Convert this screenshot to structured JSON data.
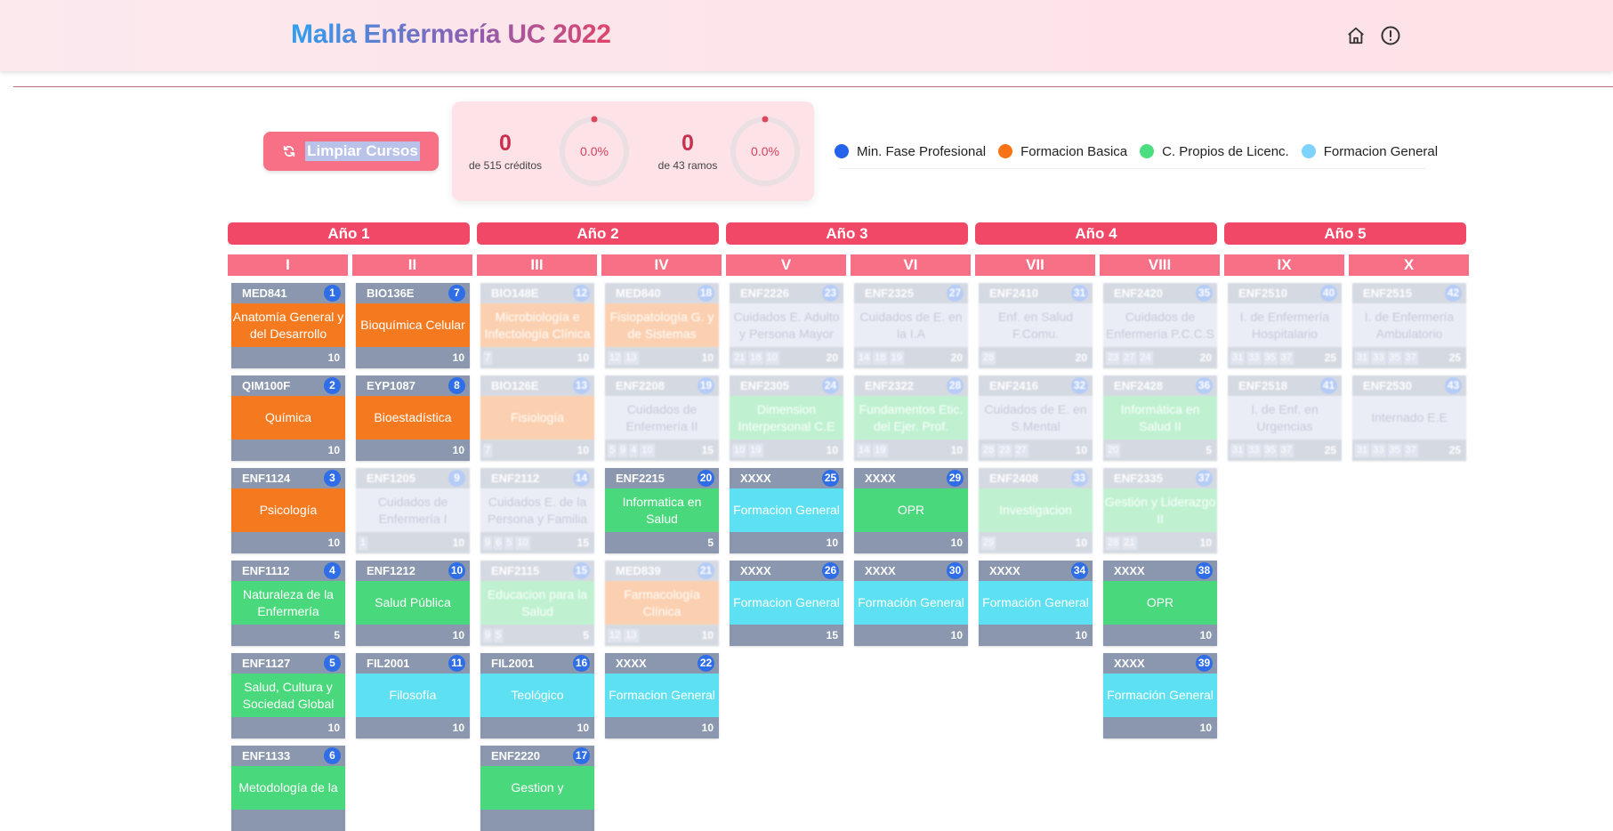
{
  "header": {
    "title": "Malla Enfermería UC 2022",
    "icons": [
      "home-icon",
      "alert-icon"
    ]
  },
  "controls": {
    "clear_label": "Limpiar Cursos",
    "clear_icon": "refresh-icon"
  },
  "stats": {
    "credits_value": "0",
    "credits_label": "de 515 créditos",
    "credits_percent": "0.0%",
    "courses_value": "0",
    "courses_label": "de 43 ramos",
    "courses_percent": "0.0%"
  },
  "legend": [
    {
      "label": "Min. Fase Profesional",
      "color": "#2563eb"
    },
    {
      "label": "Formacion Basica",
      "color": "#f97316"
    },
    {
      "label": "C. Propios de Licenc.",
      "color": "#4ade80"
    },
    {
      "label": "Formacion General",
      "color": "#7dd3fc"
    }
  ],
  "category_colors": {
    "basica": "#f57a1f",
    "licenc": "#49d97c",
    "general": "#5de0f2",
    "profesional": "#c8cde8"
  },
  "years": [
    "Año 1",
    "Año 2",
    "Año 3",
    "Año 4",
    "Año 5"
  ],
  "semesters": [
    "I",
    "II",
    "III",
    "IV",
    "V",
    "VI",
    "VII",
    "VIII",
    "IX",
    "X"
  ],
  "columns": [
    [
      {
        "code": "MED841",
        "num": "1",
        "name": "Anatomía General y del Desarrollo",
        "credits": "10",
        "prereqs": [],
        "cat": "basica",
        "active": true
      },
      {
        "code": "QIM100F",
        "num": "2",
        "name": "Química",
        "credits": "10",
        "prereqs": [],
        "cat": "basica",
        "active": true
      },
      {
        "code": "ENF1124",
        "num": "3",
        "name": "Psicología",
        "credits": "10",
        "prereqs": [],
        "cat": "basica",
        "active": true
      },
      {
        "code": "ENF1112",
        "num": "4",
        "name": "Naturaleza de la Enfermería",
        "credits": "5",
        "prereqs": [],
        "cat": "licenc",
        "active": true
      },
      {
        "code": "ENF1127",
        "num": "5",
        "name": "Salud, Cultura y Sociedad Global",
        "credits": "10",
        "prereqs": [],
        "cat": "licenc",
        "active": true
      },
      {
        "code": "ENF1133",
        "num": "6",
        "name": "Metodología de la",
        "credits": "",
        "prereqs": [],
        "cat": "licenc",
        "active": true
      }
    ],
    [
      {
        "code": "BIO136E",
        "num": "7",
        "name": "Bioquímica Celular",
        "credits": "10",
        "prereqs": [],
        "cat": "basica",
        "active": true
      },
      {
        "code": "EYP1087",
        "num": "8",
        "name": "Bioestadística",
        "credits": "10",
        "prereqs": [],
        "cat": "basica",
        "active": true
      },
      {
        "code": "ENF1205",
        "num": "9",
        "name": "Cuidados de Enfermería I",
        "credits": "10",
        "prereqs": [
          "1"
        ],
        "cat": "profesional",
        "active": false
      },
      {
        "code": "ENF1212",
        "num": "10",
        "name": "Salud Pública",
        "credits": "10",
        "prereqs": [],
        "cat": "licenc",
        "active": true
      },
      {
        "code": "FIL2001",
        "num": "11",
        "name": "Filosofía",
        "credits": "10",
        "prereqs": [],
        "cat": "general",
        "active": true
      }
    ],
    [
      {
        "code": "BIO148E",
        "num": "12",
        "name": "Microbiología e Infectología Clínica",
        "credits": "10",
        "prereqs": [
          "7"
        ],
        "cat": "basica",
        "active": false
      },
      {
        "code": "BIO126E",
        "num": "13",
        "name": "Fisiología",
        "credits": "10",
        "prereqs": [
          "7"
        ],
        "cat": "basica",
        "active": false
      },
      {
        "code": "ENF2112",
        "num": "14",
        "name": "Cuidados E. de la Persona y Familia",
        "credits": "15",
        "prereqs": [
          "9",
          "6",
          "5",
          "10"
        ],
        "cat": "profesional",
        "active": false
      },
      {
        "code": "ENF2115",
        "num": "15",
        "name": "Educacion para la Salud",
        "credits": "5",
        "prereqs": [
          "9",
          "5"
        ],
        "cat": "licenc",
        "active": false
      },
      {
        "code": "FIL2001",
        "num": "16",
        "name": "Teológico",
        "credits": "10",
        "prereqs": [],
        "cat": "general",
        "active": true
      },
      {
        "code": "ENF2220",
        "num": "17",
        "name": "Gestion y",
        "credits": "",
        "prereqs": [],
        "cat": "licenc",
        "active": true
      }
    ],
    [
      {
        "code": "MED840",
        "num": "18",
        "name": "Fisiopatología G. y de Sistemas",
        "credits": "10",
        "prereqs": [
          "12",
          "13"
        ],
        "cat": "basica",
        "active": false
      },
      {
        "code": "ENF2208",
        "num": "19",
        "name": "Cuidados de Enfermería II",
        "credits": "15",
        "prereqs": [
          "5",
          "9",
          "4",
          "10"
        ],
        "cat": "profesional",
        "active": false
      },
      {
        "code": "ENF2215",
        "num": "20",
        "name": "Informatica en Salud",
        "credits": "5",
        "prereqs": [],
        "cat": "licenc",
        "active": true
      },
      {
        "code": "MED839",
        "num": "21",
        "name": "Farmacología Clínica",
        "credits": "10",
        "prereqs": [
          "12",
          "13"
        ],
        "cat": "basica",
        "active": false
      },
      {
        "code": "XXXX",
        "num": "22",
        "name": "Formacion General",
        "credits": "10",
        "prereqs": [],
        "cat": "general",
        "active": true
      }
    ],
    [
      {
        "code": "ENF2226",
        "num": "23",
        "name": "Cuidados E. Adulto y Persona Mayor",
        "credits": "20",
        "prereqs": [
          "21",
          "18",
          "10"
        ],
        "cat": "profesional",
        "active": false
      },
      {
        "code": "ENF2305",
        "num": "24",
        "name": "Dimension Interpersonal C.E",
        "credits": "10",
        "prereqs": [
          "10",
          "19"
        ],
        "cat": "licenc",
        "active": false
      },
      {
        "code": "XXXX",
        "num": "25",
        "name": "Formacion General",
        "credits": "10",
        "prereqs": [],
        "cat": "general",
        "active": true
      },
      {
        "code": "XXXX",
        "num": "26",
        "name": "Formacion General",
        "credits": "15",
        "prereqs": [],
        "cat": "general",
        "active": true
      }
    ],
    [
      {
        "code": "ENF2325",
        "num": "27",
        "name": "Cuidados de E. en la I.A",
        "credits": "20",
        "prereqs": [
          "14",
          "18",
          "19"
        ],
        "cat": "profesional",
        "active": false
      },
      {
        "code": "ENF2322",
        "num": "28",
        "name": "Fundamentos Etic. del Ejer. Prof.",
        "credits": "10",
        "prereqs": [
          "14",
          "19"
        ],
        "cat": "licenc",
        "active": false
      },
      {
        "code": "XXXX",
        "num": "29",
        "name": "OPR",
        "credits": "10",
        "prereqs": [],
        "cat": "licenc",
        "active": true
      },
      {
        "code": "XXXX",
        "num": "30",
        "name": "Formación General",
        "credits": "10",
        "prereqs": [],
        "cat": "general",
        "active": true
      }
    ],
    [
      {
        "code": "ENF2410",
        "num": "31",
        "name": "Enf. en Salud F.Comu.",
        "credits": "20",
        "prereqs": [
          "28"
        ],
        "cat": "profesional",
        "active": false
      },
      {
        "code": "ENF2416",
        "num": "32",
        "name": "Cuidados de E. en S.Mental",
        "credits": "10",
        "prereqs": [
          "28",
          "23",
          "27"
        ],
        "cat": "profesional",
        "active": false
      },
      {
        "code": "ENF2408",
        "num": "33",
        "name": "Investigacion",
        "credits": "10",
        "prereqs": [
          "29"
        ],
        "cat": "licenc",
        "active": false
      },
      {
        "code": "XXXX",
        "num": "34",
        "name": "Formación General",
        "credits": "10",
        "prereqs": [],
        "cat": "general",
        "active": true
      }
    ],
    [
      {
        "code": "ENF2420",
        "num": "35",
        "name": "Cuidados de Enfermería P.C.C.S",
        "credits": "20",
        "prereqs": [
          "23",
          "27",
          "24"
        ],
        "cat": "profesional",
        "active": false
      },
      {
        "code": "ENF2428",
        "num": "36",
        "name": "Informática en Salud II",
        "credits": "5",
        "prereqs": [
          "20"
        ],
        "cat": "licenc",
        "active": false
      },
      {
        "code": "ENF2335",
        "num": "37",
        "name": "Gestión y Liderazgo II",
        "credits": "10",
        "prereqs": [
          "28",
          "21"
        ],
        "cat": "licenc",
        "active": false
      },
      {
        "code": "XXXX",
        "num": "38",
        "name": "OPR",
        "credits": "10",
        "prereqs": [],
        "cat": "licenc",
        "active": true
      },
      {
        "code": "XXXX",
        "num": "39",
        "name": "Formación General",
        "credits": "10",
        "prereqs": [],
        "cat": "general",
        "active": true
      }
    ],
    [
      {
        "code": "ENF2510",
        "num": "40",
        "name": "I. de Enfermería Hospitalario",
        "credits": "25",
        "prereqs": [
          "31",
          "33",
          "35",
          "37"
        ],
        "cat": "profesional",
        "active": false
      },
      {
        "code": "ENF2518",
        "num": "41",
        "name": "I. de Enf. en Urgencias",
        "credits": "25",
        "prereqs": [
          "31",
          "33",
          "35",
          "37"
        ],
        "cat": "profesional",
        "active": false
      }
    ],
    [
      {
        "code": "ENF2515",
        "num": "42",
        "name": "I. de Enfermería Ambulatorio",
        "credits": "25",
        "prereqs": [
          "31",
          "33",
          "35",
          "37"
        ],
        "cat": "profesional",
        "active": false
      },
      {
        "code": "ENF2530",
        "num": "43",
        "name": "Internado E.E",
        "credits": "25",
        "prereqs": [
          "31",
          "33",
          "35",
          "37"
        ],
        "cat": "profesional",
        "active": false
      }
    ]
  ]
}
